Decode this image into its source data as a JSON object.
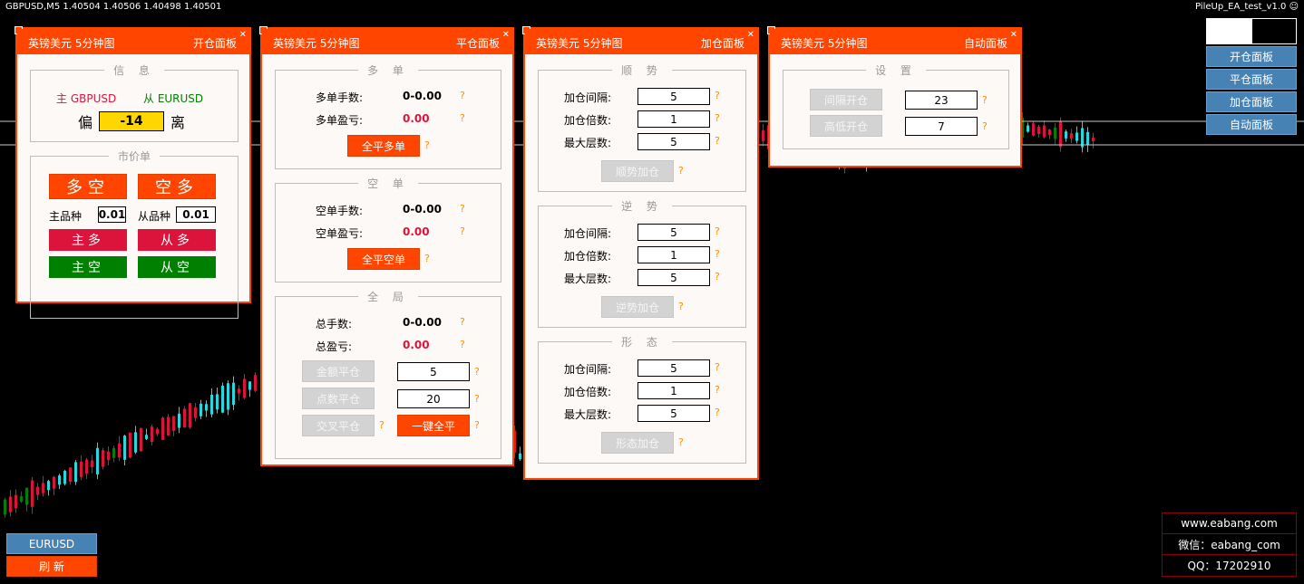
{
  "chart": {
    "symbol_info": "GBPUSD,M5  1.40504 1.40506 1.40498 1.40501",
    "ea_name": "PileUp_EA_test_v1.0",
    "smiley": "☺"
  },
  "colors": {
    "accent": "#ff4500",
    "crimson": "#dc143c",
    "green": "#008000",
    "blue": "#4682b4",
    "yellow": "#ffd700",
    "bull_candle": "#26d9e0",
    "bear_candle": "#dc143c"
  },
  "panel_common": {
    "title": "英镑美元 5分钟图",
    "close": "✕",
    "help": "?"
  },
  "open_panel": {
    "name": "开仓面板",
    "info_title": "信 息",
    "main_symbol": "主 GBPUSD",
    "sub_symbol": "从 EURUSD",
    "deviation_left": "偏",
    "deviation_value": "-14",
    "deviation_right": "离",
    "market_title": "市价单",
    "long_short_button": "多空",
    "short_long_button": "空多",
    "main_lot_label": "主品种",
    "main_lot_value": "0.01",
    "sub_lot_label": "从品种",
    "sub_lot_value": "0.01",
    "main_long_button": "主多",
    "sub_long_button": "从多",
    "main_short_button": "主空",
    "sub_short_button": "从空"
  },
  "close_panel": {
    "name": "平仓面板",
    "long_group": {
      "title": "多 单",
      "lots_label": "多单手数:",
      "lots_value": "0-0.00",
      "pnl_label": "多单盈亏:",
      "pnl_value": "0.00",
      "button": "全平多单"
    },
    "short_group": {
      "title": "空 单",
      "lots_label": "空单手数:",
      "lots_value": "0-0.00",
      "pnl_label": "空单盈亏:",
      "pnl_value": "0.00",
      "button": "全平空单"
    },
    "global_group": {
      "title": "全 局",
      "lots_label": "总手数:",
      "lots_value": "0-0.00",
      "pnl_label": "总盈亏:",
      "pnl_value": "0.00",
      "amount_button": "金额平仓",
      "amount_value": "5",
      "points_button": "点数平仓",
      "points_value": "20",
      "cross_button": "交叉平仓",
      "close_all_button": "一键全平"
    }
  },
  "add_panel": {
    "name": "加仓面板",
    "trend_group": {
      "title": "顺 势",
      "interval_label": "加仓间隔:",
      "interval_value": "5",
      "multiplier_label": "加仓倍数:",
      "multiplier_value": "1",
      "max_label": "最大层数:",
      "max_value": "5",
      "button": "顺势加仓"
    },
    "counter_group": {
      "title": "逆 势",
      "interval_label": "加仓间隔:",
      "interval_value": "5",
      "multiplier_label": "加仓倍数:",
      "multiplier_value": "1",
      "max_label": "最大层数:",
      "max_value": "5",
      "button": "逆势加仓"
    },
    "pattern_group": {
      "title": "形 态",
      "interval_label": "加仓间隔:",
      "interval_value": "5",
      "multiplier_label": "加仓倍数:",
      "multiplier_value": "1",
      "max_label": "最大层数:",
      "max_value": "5",
      "button": "形态加仓"
    }
  },
  "auto_panel": {
    "name": "自动面板",
    "settings_title": "设 置",
    "interval_button": "间隔开仓",
    "interval_value": "23",
    "highlow_button": "高低开仓",
    "highlow_value": "7"
  },
  "right_menu": {
    "items": [
      "开仓面板",
      "平仓面板",
      "加仓面板",
      "自动面板"
    ]
  },
  "bottom_left": {
    "symbol_button": "EURUSD",
    "refresh_button": "刷 新"
  },
  "contact": {
    "website": "www.eabang.com",
    "wechat": "微信：eabang_com",
    "qq": "QQ：17202910"
  }
}
